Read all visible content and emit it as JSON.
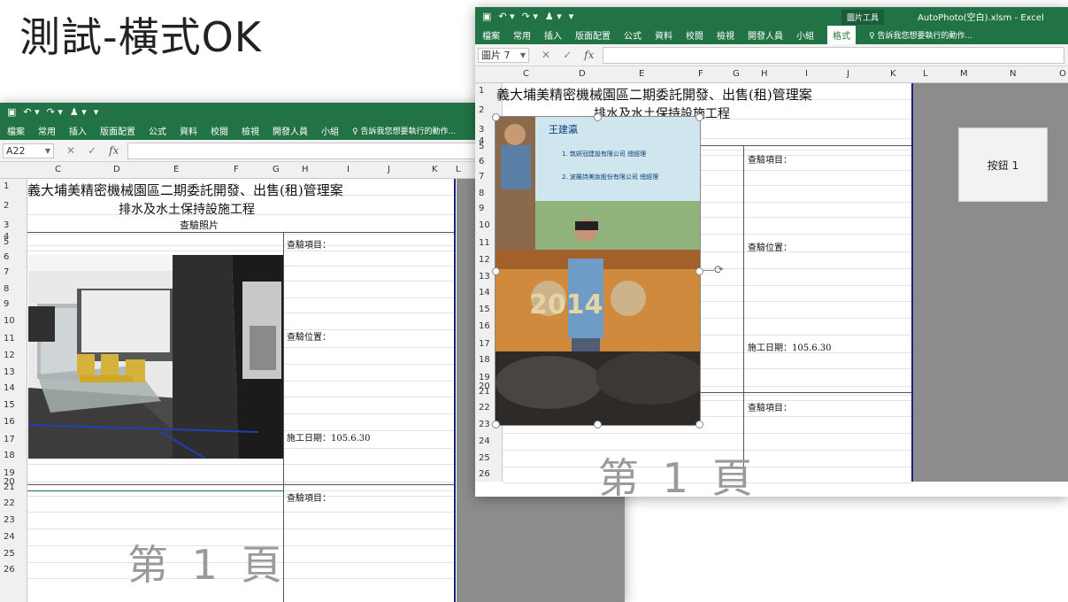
{
  "slide": {
    "title": "測試-橫式OK"
  },
  "excel": {
    "qat_icons": [
      "save-icon",
      "undo-icon",
      "redo-icon",
      "macro-icon"
    ],
    "tabs": [
      "檔案",
      "常用",
      "插入",
      "版面配置",
      "公式",
      "資料",
      "校閱",
      "檢視",
      "開發人員",
      "小組"
    ],
    "tell_me": "告訴我您想要執行的動作...",
    "formula_icons": {
      "cancel": "✕",
      "enter": "✓",
      "fx": "fx"
    },
    "back": {
      "name_box": "A22",
      "columns": [
        "C",
        "D",
        "E",
        "F",
        "G",
        "H",
        "I",
        "J",
        "K",
        "L"
      ],
      "rows": [
        "1",
        "2",
        "3",
        "4",
        "5",
        "6",
        "7",
        "8",
        "9",
        "10",
        "11",
        "12",
        "13",
        "14",
        "15",
        "16",
        "17",
        "18",
        "19",
        "20",
        "21",
        "22",
        "23",
        "24",
        "25",
        "26"
      ]
    },
    "front": {
      "name_box": "圖片 7",
      "window_title": "AutoPhoto(空白).xlsm - Excel",
      "context_tab_group": "圖片工具",
      "context_tab": "格式",
      "columns": [
        "C",
        "D",
        "E",
        "F",
        "G",
        "H",
        "I",
        "J",
        "K",
        "L",
        "M",
        "N",
        "O"
      ],
      "rows": [
        "1",
        "2",
        "3",
        "4",
        "5",
        "6",
        "7",
        "8",
        "9",
        "10",
        "11",
        "12",
        "13",
        "14",
        "15",
        "16",
        "17",
        "18",
        "19",
        "20",
        "21",
        "22",
        "23",
        "24",
        "25",
        "26"
      ],
      "button_label": "按鈕 1"
    },
    "document": {
      "title_line1": "義大埔美精密機械園區二期委託開發、出售(租)管理案",
      "title_line2": "排水及水土保持設施工程",
      "title_line3": "查驗照片",
      "label_item": "查驗項目：",
      "label_location": "查驗位置：",
      "label_date": "施工日期：105.6.30",
      "page_watermark": "第 1 頁"
    },
    "photo": {
      "banner_name": "王建瀛",
      "banner_line1": "1. 筑妍冠建設有限公司 總經理",
      "banner_line2": "2. 波羅詩美妝股份有限公司 總經理",
      "stage_number": "2014"
    }
  },
  "colors": {
    "excel_green": "#217346",
    "border_blue": "#1a237e",
    "grey_area": "#8c8c8c"
  }
}
